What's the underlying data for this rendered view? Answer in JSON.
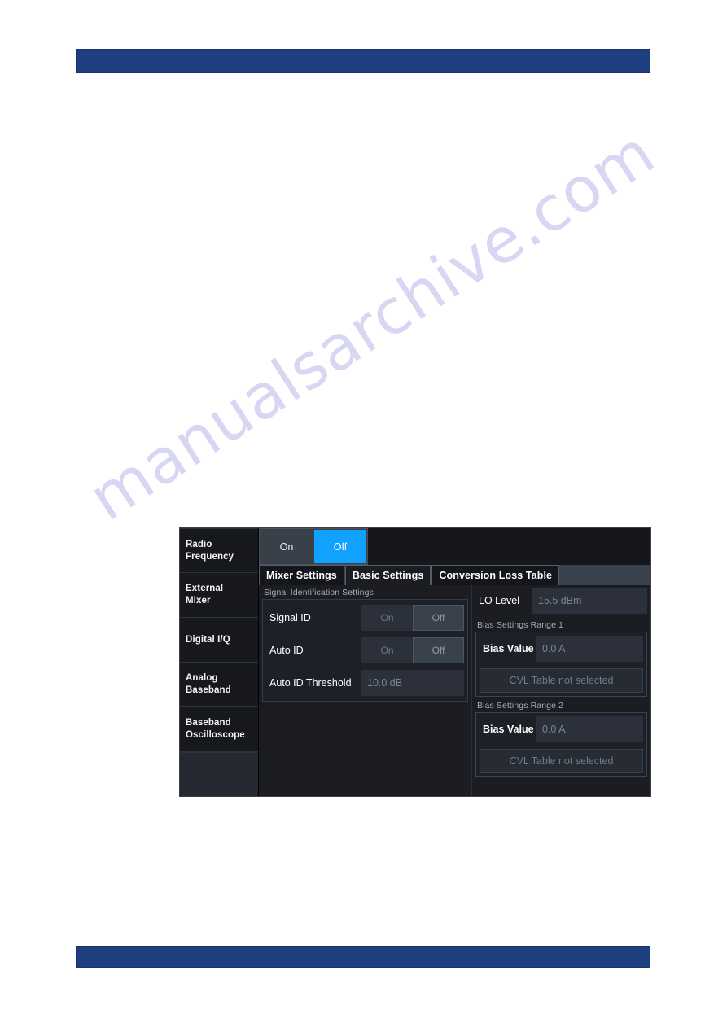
{
  "page": {
    "watermark": "manualsarchive.com"
  },
  "dialog": {
    "nav": {
      "items": [
        {
          "label_line1": "Radio",
          "label_line2": "Frequency"
        },
        {
          "label_line1": "External",
          "label_line2": "Mixer"
        },
        {
          "label_line1": "Digital I/Q",
          "label_line2": ""
        },
        {
          "label_line1": "Analog",
          "label_line2": "Baseband"
        },
        {
          "label_line1": "Baseband",
          "label_line2": "Oscilloscope"
        }
      ]
    },
    "master_state": {
      "on_label": "On",
      "off_label": "Off",
      "selected": "Off",
      "accent_color": "#11a1ff"
    },
    "tabs": [
      {
        "label": "Mixer Settings",
        "active": false
      },
      {
        "label": "Basic Settings",
        "active": true
      },
      {
        "label": "Conversion Loss Table",
        "active": false
      }
    ],
    "signal_identification": {
      "caption": "Signal Identification Settings",
      "signal_id": {
        "label": "Signal ID",
        "on_label": "On",
        "off_label": "Off",
        "selected": "Off"
      },
      "auto_id": {
        "label": "Auto ID",
        "on_label": "On",
        "off_label": "Off",
        "selected": "Off"
      },
      "auto_id_threshold": {
        "label": "Auto ID Threshold",
        "value": "10.0 dB"
      }
    },
    "mixer_right": {
      "lo_level": {
        "label": "LO Level",
        "value": "15.5 dBm"
      },
      "bias_range_1": {
        "caption": "Bias Settings Range 1",
        "bias_label": "Bias Value",
        "bias_value": "0.0 A",
        "cvl_button": "CVL Table not selected"
      },
      "bias_range_2": {
        "caption": "Bias Settings Range 2",
        "bias_label": "Bias Value",
        "bias_value": "0.0 A",
        "cvl_button": "CVL Table not selected"
      }
    }
  }
}
